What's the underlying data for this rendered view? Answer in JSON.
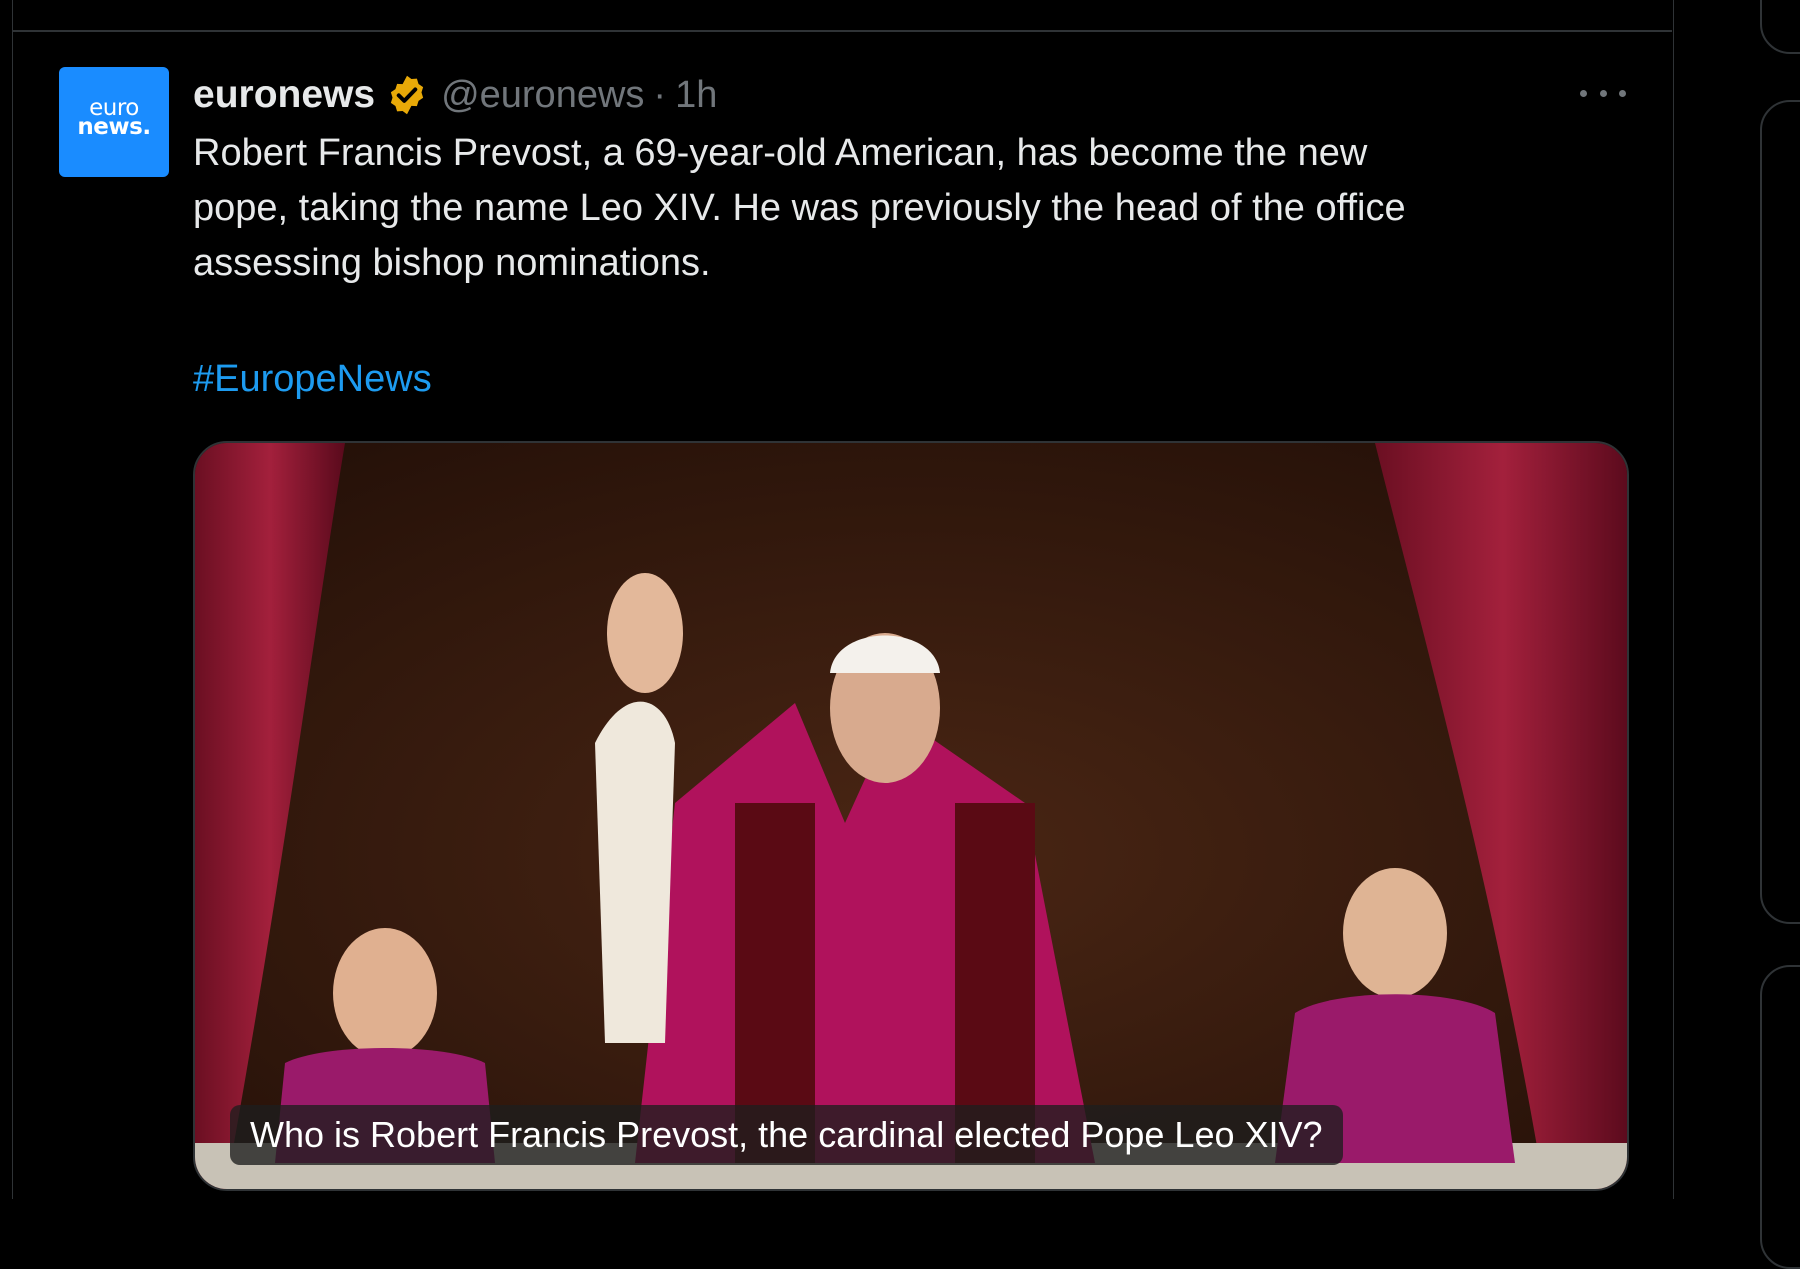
{
  "post": {
    "avatar": {
      "line1": "euro",
      "line2": "news.",
      "color": "#1a8cff"
    },
    "display_name": "euronews",
    "verified_badge_icon": "gold-verified-badge-icon",
    "handle": "@euronews",
    "separator": "·",
    "time": "1h",
    "more_icon": "more-horizontal-icon",
    "text_lines": [
      "Robert Francis Prevost, a 69-year-old American, has become the new",
      "pope, taking the name Leo XIV. He was previously the head of the office",
      "assessing bishop nominations."
    ],
    "hashtag": "#EuropeNews",
    "media": {
      "description_icon": "photo-of-pope-waving-from-balcony",
      "caption": "Who is Robert Francis Prevost, the cardinal elected Pope Leo XIV?"
    }
  },
  "colors": {
    "background": "#000000",
    "text": "#e7e9ea",
    "muted": "#71767b",
    "link": "#1d9bf0",
    "border": "#2f3336",
    "badge": "#e8a908"
  }
}
